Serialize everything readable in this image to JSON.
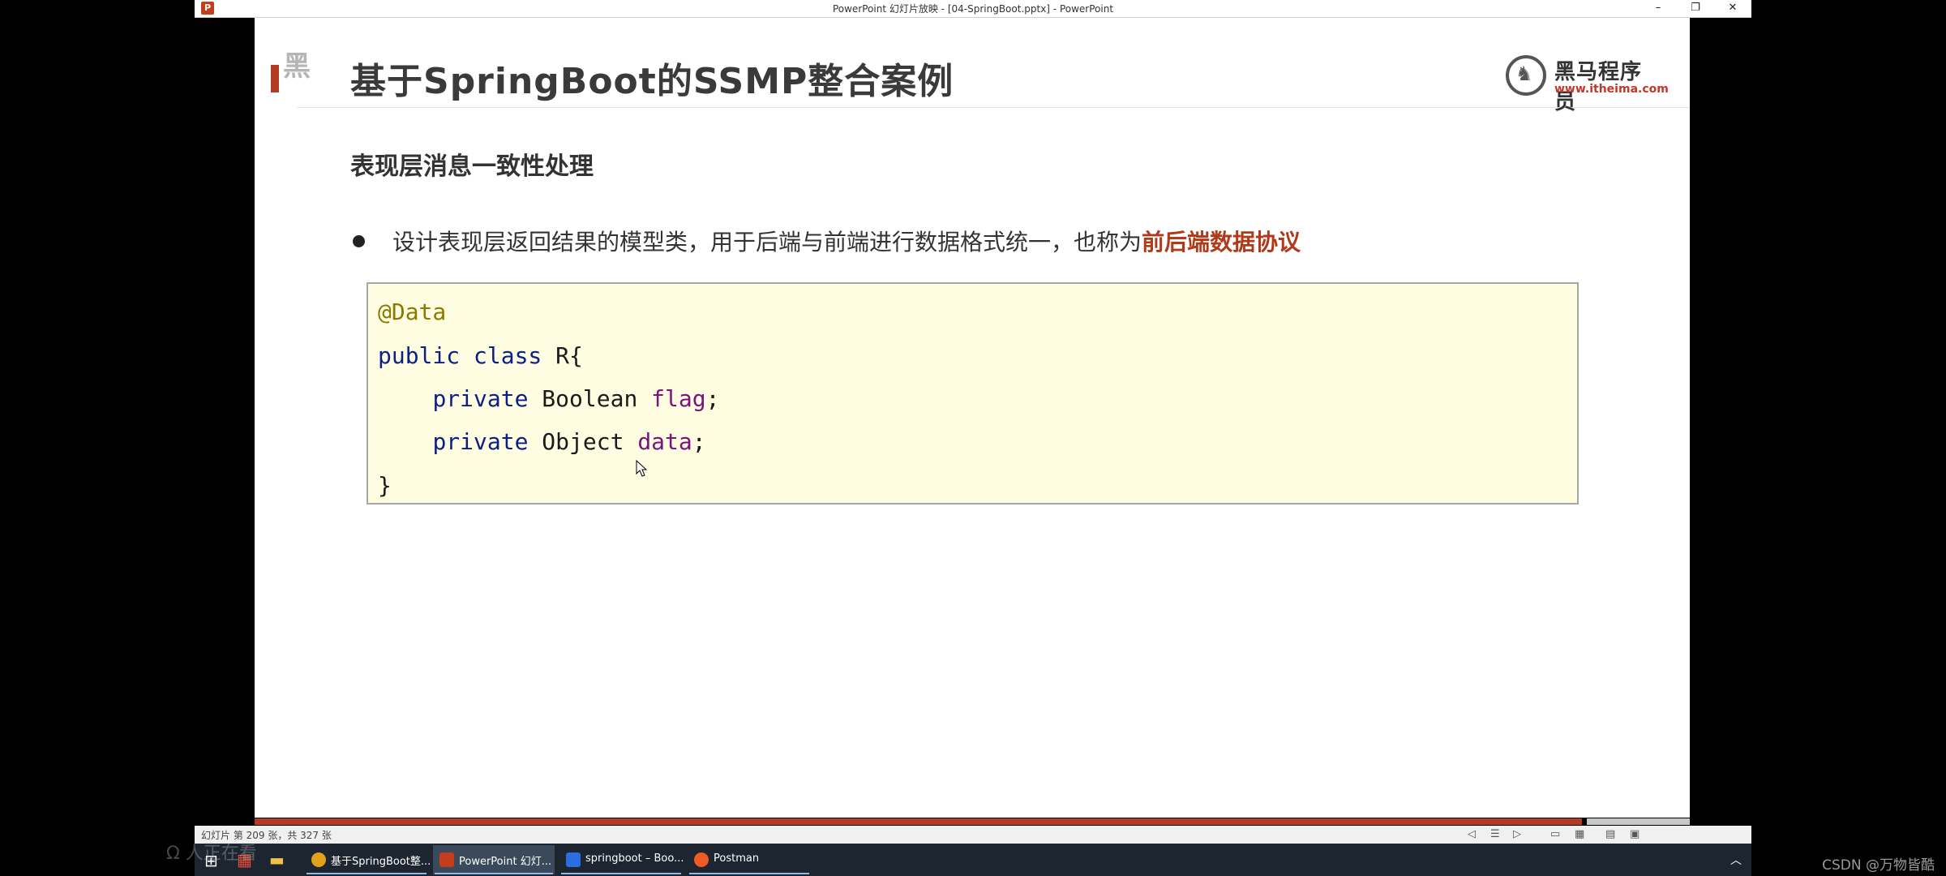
{
  "window": {
    "title": "PowerPoint 幻灯片放映 - [04-SpringBoot.pptx] - PowerPoint",
    "app_icon": "P",
    "controls": {
      "minimize": "–",
      "restore": "❐",
      "close": "✕"
    }
  },
  "slide": {
    "watermark": "黑",
    "title": "基于SpringBoot的SSMP整合案例",
    "logo": {
      "name": "黑马程序员",
      "url": "www.itheima.com",
      "icon": "horse-icon"
    },
    "section_heading": "表现层消息一致性处理",
    "bullet": {
      "text": "设计表现层返回结果的模型类，用于后端与前端进行数据格式统一，也称为",
      "highlight": "前后端数据协议"
    },
    "code": {
      "annotation": "@Data",
      "class_kw": "public class",
      "class_name": " R{",
      "field1_kw": "private",
      "field1_type": " Boolean ",
      "field1_name": "flag",
      "field1_end": ";",
      "field2_kw": "private",
      "field2_type": " Object ",
      "field2_name": "data",
      "field2_end": ";",
      "close": "}"
    }
  },
  "status": {
    "slide_counter": "幻灯片 第 209 张，共 327 张",
    "progress": 0.639
  },
  "taskbar": {
    "tasks": [
      {
        "label": "基于SpringBoot整...",
        "color": "#e3a21a"
      },
      {
        "label": "PowerPoint 幻灯...",
        "color": "#c43e1c"
      },
      {
        "label": "springboot – Boo...",
        "color": "#2a6ee0"
      },
      {
        "label": "Postman",
        "color": "#ef5b25"
      }
    ]
  },
  "overlay_text": "Ω 人正在看",
  "csdn_watermark": "CSDN @万物皆酷",
  "colors": {
    "accent_red": "#b53a22",
    "code_bg": "#fefde2",
    "highlight": "#b03a1a"
  }
}
